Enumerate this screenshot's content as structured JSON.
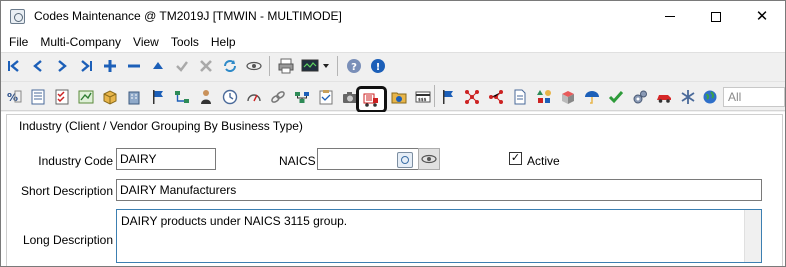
{
  "window": {
    "title": "Codes Maintenance @ TM2019J [TMWIN - MULTIMODE]",
    "minimize_glyph": "—",
    "maximize_glyph": "☐",
    "close_glyph": "✕"
  },
  "menu": [
    "File",
    "Multi-Company",
    "View",
    "Tools",
    "Help"
  ],
  "toolbar1": {
    "items": [
      {
        "icon": "first-record-icon",
        "glyph": "K"
      },
      {
        "icon": "previous-record-icon",
        "glyph": "<"
      },
      {
        "icon": "next-record-icon",
        "glyph": ">"
      },
      {
        "icon": "last-record-icon",
        "glyph": ">|"
      },
      {
        "icon": "add-icon",
        "glyph": "+"
      },
      {
        "icon": "delete-icon",
        "glyph": "−"
      },
      {
        "icon": "move-up-icon",
        "glyph": "▲"
      },
      {
        "icon": "save-check-icon",
        "glyph": "✔"
      },
      {
        "icon": "cancel-x-icon",
        "glyph": "✖"
      },
      {
        "icon": "refresh-icon",
        "glyph": "↻"
      },
      {
        "icon": "view-eye-icon",
        "glyph": "◎"
      },
      {
        "icon": "print-icon",
        "glyph": "▤"
      },
      {
        "icon": "monitor-dropdown-icon",
        "glyph": "▬"
      },
      {
        "icon": "help-icon",
        "glyph": "?"
      },
      {
        "icon": "info-icon",
        "glyph": "!"
      }
    ],
    "accent_blue": "#1c5fb8"
  },
  "toolbar2": {
    "icon_names": [
      "percent-code-icon",
      "document-list-icon",
      "checklist-icon",
      "chart-image-icon",
      "package-box-icon",
      "building-icon",
      "flag-icon",
      "hierarchy-arrow-icon",
      "person-icon",
      "clock-icon",
      "gauge-icon",
      "chain-link-icon",
      "network-icon",
      "clipboard-icon",
      "camera-icon",
      "truck-dealer-icon",
      "money-folder-icon",
      "credit-card-icon",
      "blue-flag-icon",
      "network-red-icon",
      "red-nodes-icon",
      "document-icon",
      "shapes-icon",
      "box-red-icon",
      "arrow-umbrella-icon",
      "green-check-icon",
      "gears-icon",
      "red-car-icon",
      "asterisk-icon",
      "globe-icon"
    ],
    "highlighted_icon": "truck-dealer-icon",
    "search_placeholder": "All"
  },
  "form": {
    "group_title": "Industry (Client / Vendor Grouping By Business Type)",
    "industry_code_label": "Industry Code",
    "industry_code_value": "DAIRY",
    "naics_label": "NAICS",
    "naics_value": "",
    "active_label": "Active",
    "active_checked": true,
    "active_check_glyph": "✓",
    "short_description_label": "Short Description",
    "short_description_value": "DAIRY Manufacturers",
    "long_description_label": "Long Description",
    "long_description_value": "DAIRY products under NAICS 3115 group."
  }
}
